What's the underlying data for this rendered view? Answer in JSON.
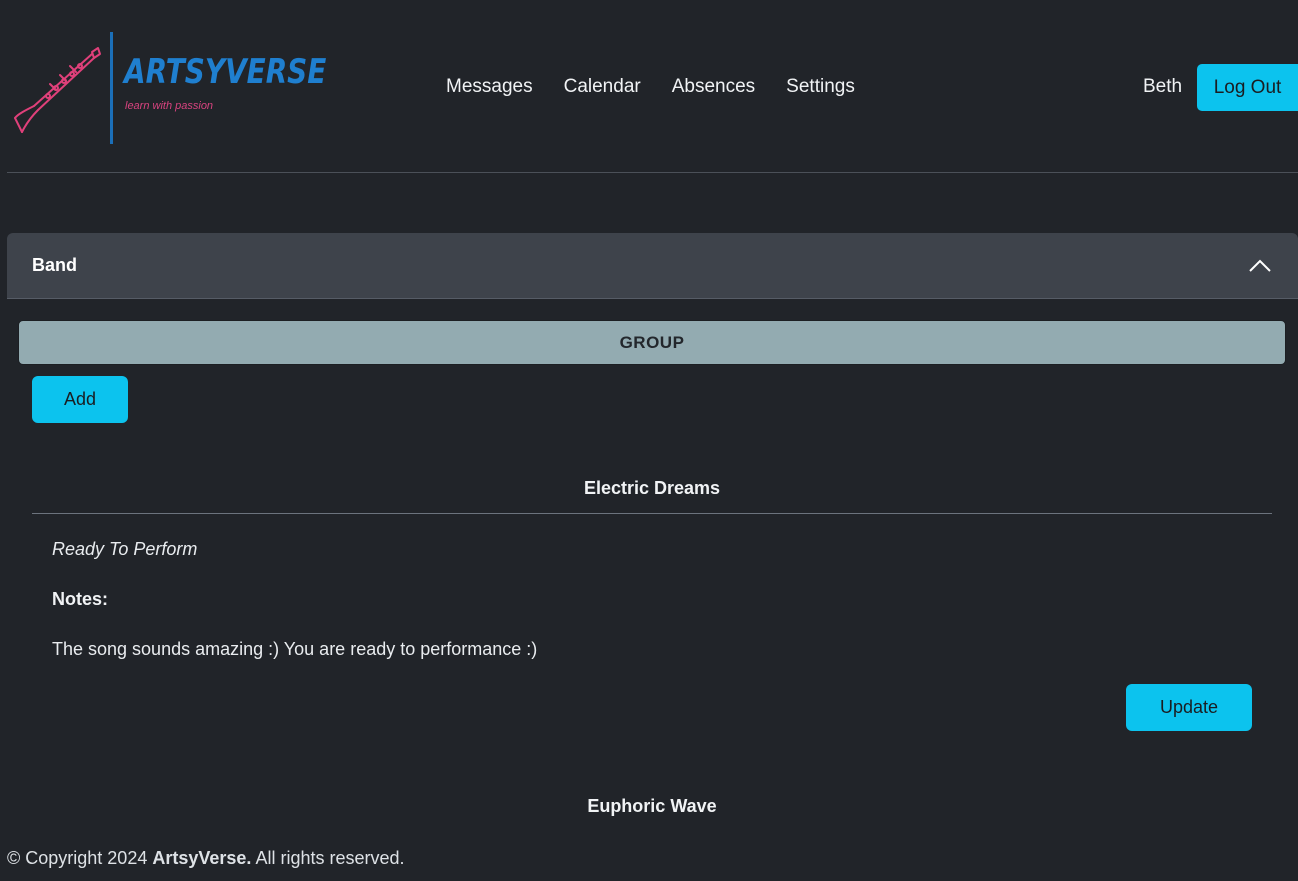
{
  "brand": {
    "title": "ARTSYVERSE",
    "tagline": "learn with passion",
    "accent_blue": "#1f7fcf",
    "accent_pink": "#d8437f"
  },
  "nav": {
    "items": [
      {
        "label": "Messages"
      },
      {
        "label": "Calendar"
      },
      {
        "label": "Absences"
      },
      {
        "label": "Settings"
      }
    ]
  },
  "user": {
    "name": "Beth",
    "logout_label": "Log Out"
  },
  "section": {
    "title": "Band",
    "toggle_icon": "chevron-up-icon",
    "group_label": "GROUP",
    "add_label": "Add"
  },
  "songs": [
    {
      "title": "Electric Dreams",
      "status": "Ready To Perform",
      "notes_label": "Notes:",
      "notes": "The song sounds amazing :) You are ready to performance :)",
      "update_label": "Update"
    },
    {
      "title": "Euphoric Wave"
    }
  ],
  "footer": {
    "prefix": "© Copyright 2024",
    "brand": "ArtsyVerse.",
    "suffix": "All rights reserved."
  },
  "colors": {
    "background": "#212429",
    "button_cyan": "#0cc3ee",
    "accordion_header": "#3e434b",
    "group_bar": "#93abb1"
  }
}
